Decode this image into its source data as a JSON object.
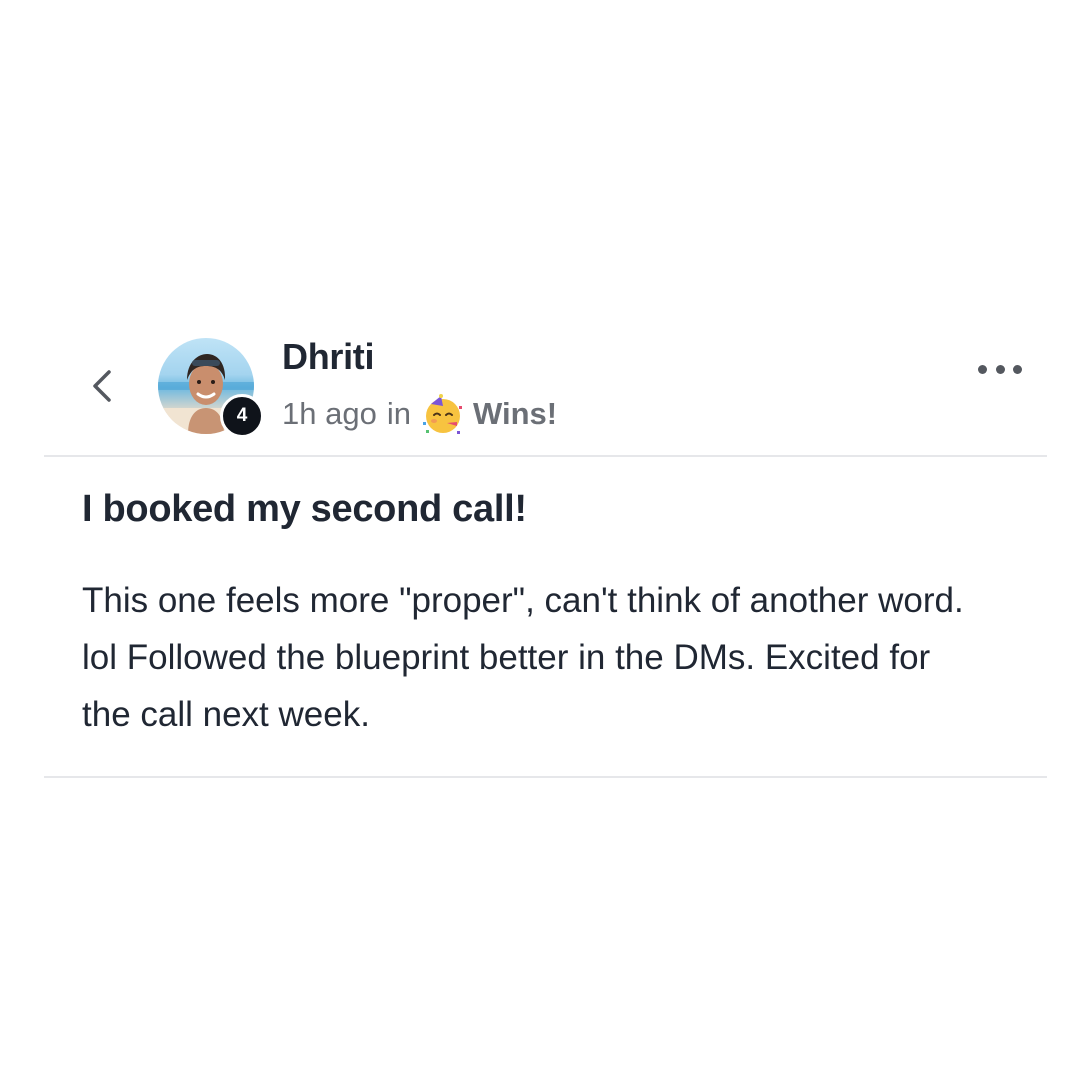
{
  "post": {
    "author": {
      "name": "Dhriti",
      "level": "4",
      "avatar_icon": "user-avatar-photo"
    },
    "meta": {
      "time_ago": "1h ago",
      "in_word": "in",
      "category_icon": "partying-face-emoji",
      "category": "Wins!"
    },
    "title": "I booked my second call!",
    "body": "This one feels more \"proper\", can't think of another word. lol Followed the blueprint better in the DMs. Excited for the call next week."
  },
  "nav": {
    "back_icon": "chevron-left-icon",
    "more_icon": "more-horizontal-icon"
  },
  "colors": {
    "text_primary": "#202733",
    "text_secondary": "#6b6f76",
    "badge_bg": "#0f131a",
    "divider": "#e6e7ea"
  }
}
